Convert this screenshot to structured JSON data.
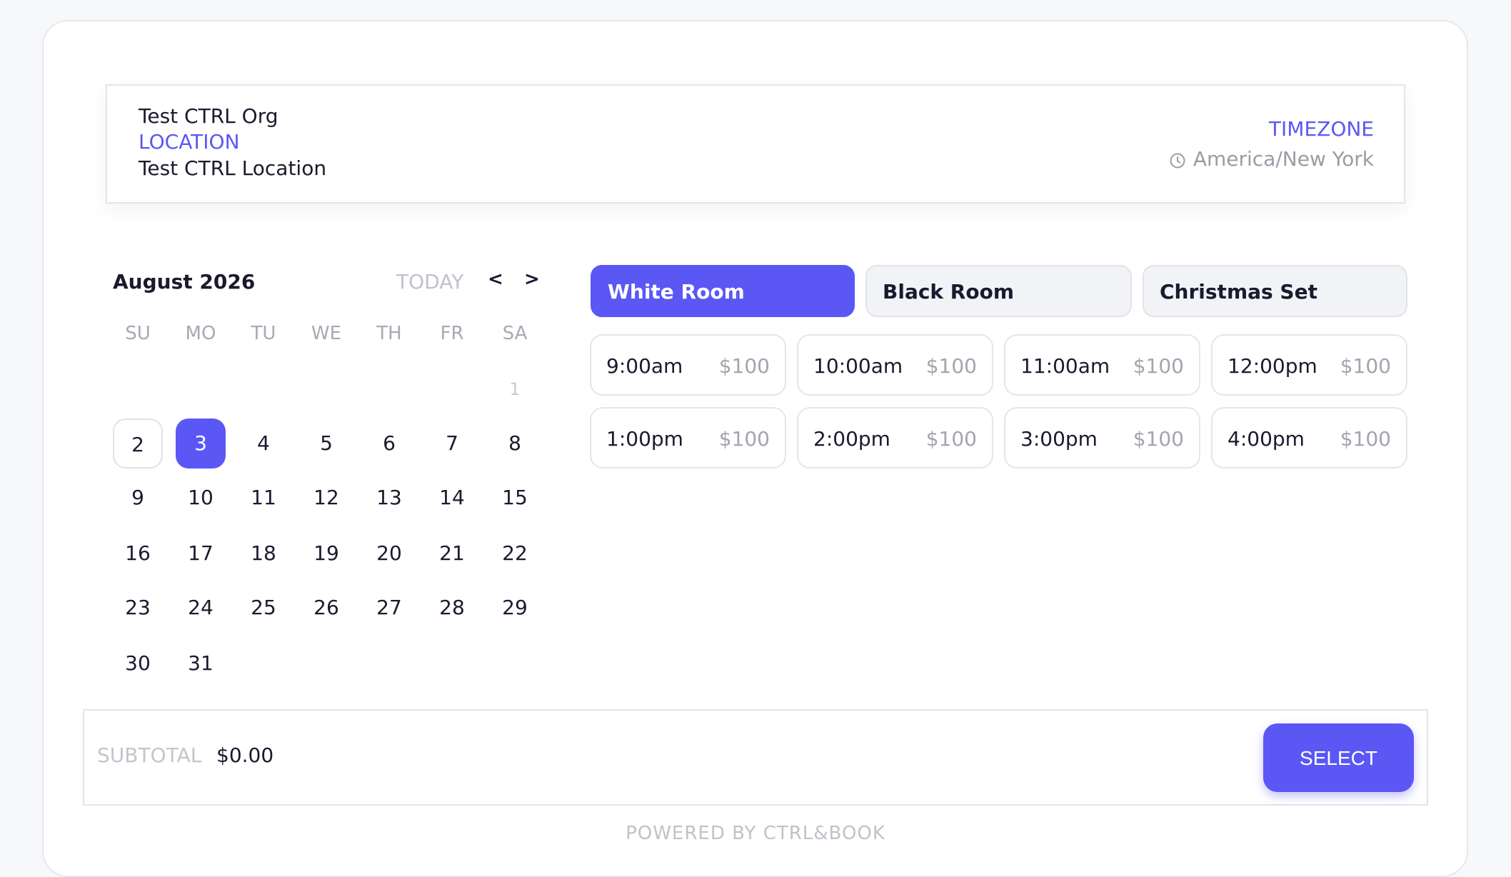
{
  "header": {
    "org_name": "Test CTRL Org",
    "location_label": "LOCATION",
    "location_name": "Test CTRL Location",
    "timezone_label": "TIMEZONE",
    "timezone_value": "America/New York"
  },
  "calendar": {
    "month_label": "August 2026",
    "today_label": "TODAY",
    "prev_label": "<",
    "next_label": ">",
    "weekdays": [
      "SU",
      "MO",
      "TU",
      "WE",
      "TH",
      "FR",
      "SA"
    ],
    "days": [
      "1",
      "2",
      "3",
      "4",
      "5",
      "6",
      "7",
      "8",
      "9",
      "10",
      "11",
      "12",
      "13",
      "14",
      "15",
      "16",
      "17",
      "18",
      "19",
      "20",
      "21",
      "22",
      "23",
      "24",
      "25",
      "26",
      "27",
      "28",
      "29",
      "30",
      "31"
    ],
    "selected_day": "3",
    "today_day": "2"
  },
  "rooms": [
    {
      "label": "White Room",
      "active": true
    },
    {
      "label": "Black Room",
      "active": false
    },
    {
      "label": "Christmas Set",
      "active": false
    }
  ],
  "slots": [
    {
      "time": "9:00am",
      "price": "$100"
    },
    {
      "time": "10:00am",
      "price": "$100"
    },
    {
      "time": "11:00am",
      "price": "$100"
    },
    {
      "time": "12:00pm",
      "price": "$100"
    },
    {
      "time": "1:00pm",
      "price": "$100"
    },
    {
      "time": "2:00pm",
      "price": "$100"
    },
    {
      "time": "3:00pm",
      "price": "$100"
    },
    {
      "time": "4:00pm",
      "price": "$100"
    }
  ],
  "footer": {
    "subtotal_label": "SUBTOTAL",
    "subtotal_value": "$0.00",
    "select_label": "SELECT",
    "powered_by": "POWERED BY CTRL&BOOK"
  },
  "colors": {
    "accent": "#5b57f5",
    "muted_text": "#a7a9b3"
  }
}
